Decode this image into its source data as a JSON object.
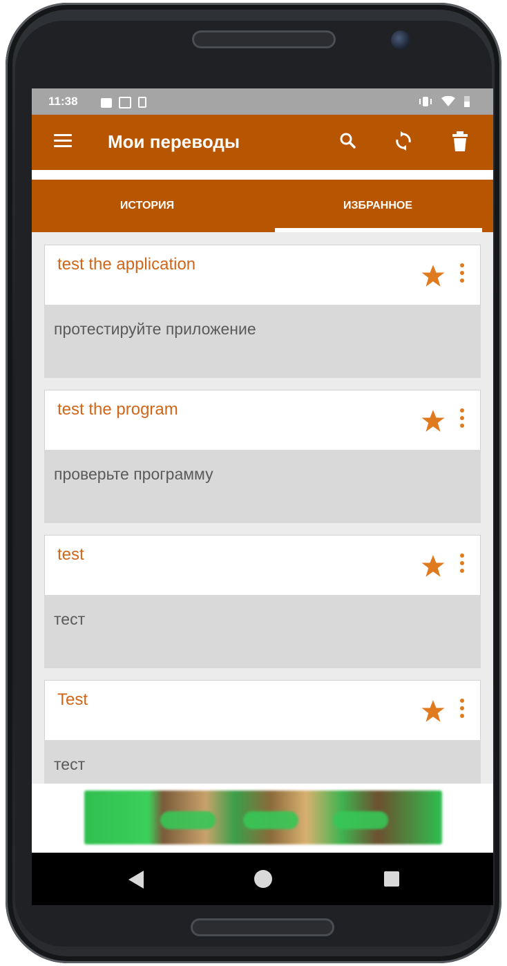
{
  "statusbar": {
    "time": "11:38"
  },
  "appbar": {
    "title": "Мои переводы",
    "color": "#b85500",
    "icons": [
      "menu-icon",
      "search-icon",
      "sync-icon",
      "trash-icon"
    ]
  },
  "tabs": [
    {
      "label": "ИСТОРИЯ",
      "selected": false
    },
    {
      "label": "ИЗБРАННОЕ",
      "selected": true
    }
  ],
  "cards": [
    {
      "source": "test the application",
      "target": "протестируйте приложение",
      "favorite": true
    },
    {
      "source": "test the program",
      "target": "проверьте программу",
      "favorite": true
    },
    {
      "source": "test",
      "target": "тест",
      "favorite": true
    },
    {
      "source": "Test",
      "target": "тест",
      "favorite": true
    }
  ],
  "colors": {
    "accent": "#e07a1f",
    "source_text": "#d0661a",
    "card_bottom": "#d9d9d9"
  },
  "navbar": {
    "icons": [
      "back-icon",
      "home-icon",
      "recents-icon"
    ]
  }
}
